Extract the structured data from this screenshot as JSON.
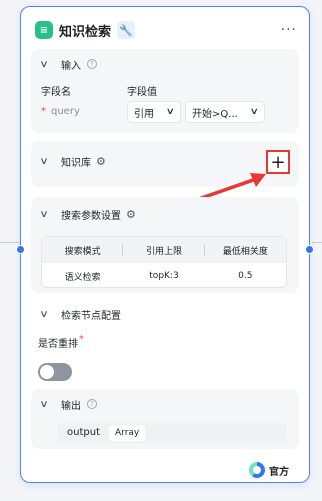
{
  "node": {
    "title": "知识检索",
    "more_label": "···",
    "official_label": "官方"
  },
  "input_section": {
    "title": "输入",
    "col_name_label": "字段名",
    "col_value_label": "字段值",
    "required_mark": "*",
    "field_name": "query",
    "ref_type": "引用",
    "ref_value": "开始>Q..."
  },
  "knowledge_section": {
    "title": "知识库",
    "add_label": "+"
  },
  "search_params_section": {
    "title": "搜索参数设置",
    "headers": [
      "搜索模式",
      "引用上限",
      "最低相关度"
    ],
    "row": [
      "语义检索",
      "topK:3",
      "0.5"
    ]
  },
  "retrieval_node_section": {
    "title": "检索节点配置",
    "rerank_label": "是否重排",
    "required_mark": "*",
    "rerank_enabled": false
  },
  "output_section": {
    "title": "输出",
    "output_name": "output",
    "output_type": "Array"
  },
  "colors": {
    "accent": "#3574f0",
    "annotation_red": "#e53935",
    "node_border": "#4e83fd"
  }
}
